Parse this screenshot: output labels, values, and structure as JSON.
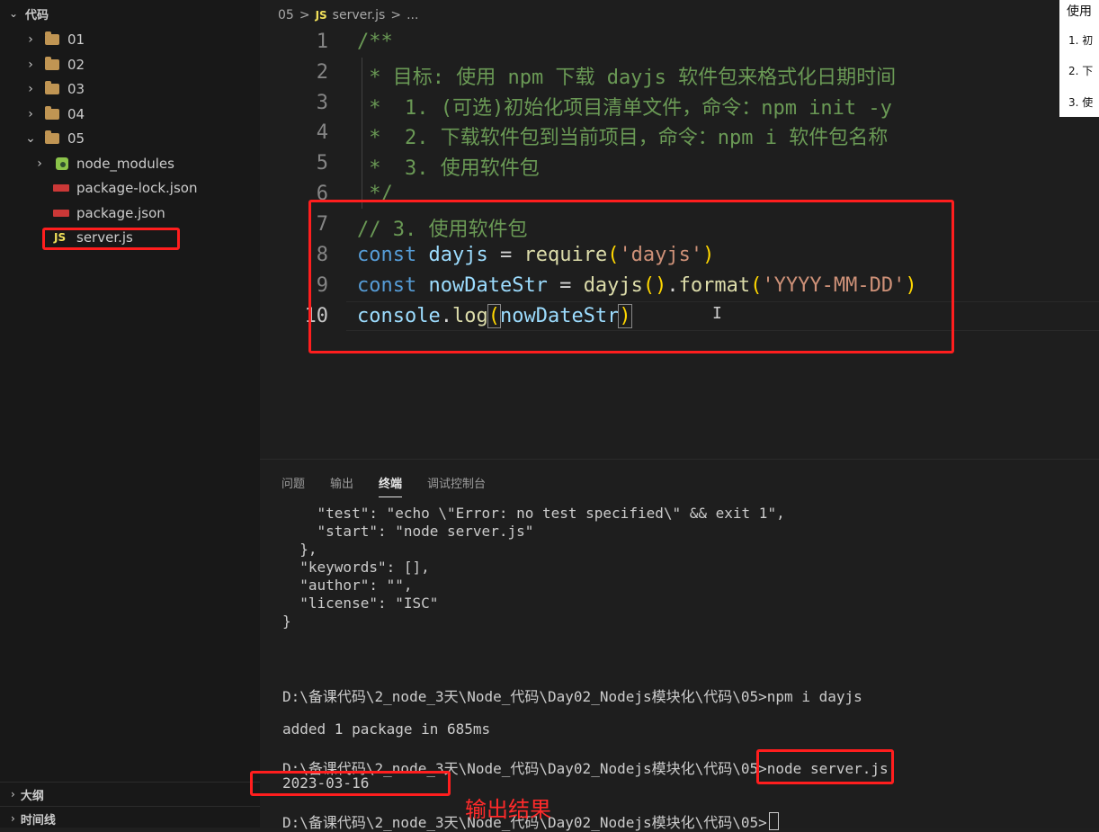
{
  "sidebar": {
    "root_label": "代码",
    "items": [
      {
        "label": "01"
      },
      {
        "label": "02"
      },
      {
        "label": "03"
      },
      {
        "label": "04"
      },
      {
        "label": "05"
      }
    ],
    "children": [
      {
        "label": "node_modules"
      },
      {
        "label": "package-lock.json"
      },
      {
        "label": "package.json"
      },
      {
        "label": "server.js"
      }
    ],
    "outline_label": "大纲",
    "timeline_label": "时间线"
  },
  "editor": {
    "breadcrumb": {
      "folder": "05",
      "sep1": ">",
      "js_badge": "JS",
      "file": "server.js",
      "sep2": ">",
      "ellipsis": "..."
    },
    "line_numbers": [
      "1",
      "2",
      "3",
      "4",
      "5",
      "6",
      "7",
      "8",
      "9",
      "10"
    ],
    "lines": {
      "l1": "/**",
      "l2": " * 目标: 使用 npm 下载 dayjs 软件包来格式化日期时间",
      "l3": " *  1. (可选)初始化项目清单文件，命令：npm init -y",
      "l4": " *  2. 下载软件包到当前项目，命令：npm i 软件包名称",
      "l5": " *  3. 使用软件包",
      "l6": " */",
      "l7": "// 3. 使用软件包",
      "l8": {
        "kw": "const",
        "name": " dayjs",
        "eq": " = ",
        "fn": "require",
        "p1": "(",
        "str": "'dayjs'",
        "p2": ")"
      },
      "l9": {
        "kw": "const",
        "name": " nowDateStr",
        "eq": " = ",
        "fn1": "dayjs",
        "p1": "()",
        "dot": ".",
        "fn2": "format",
        "p2": "(",
        "str": "'YYYY-MM-DD'",
        "p3": ")"
      },
      "l10": {
        "obj": "console",
        "dot": ".",
        "fn": "log",
        "p1": "(",
        "arg": "nowDateStr",
        "p2": ")"
      }
    }
  },
  "preview": {
    "title": "使用",
    "items": [
      {
        "num": "1.",
        "text": "初"
      },
      {
        "num": "2.",
        "text": "下"
      },
      {
        "num": "3.",
        "text": "使"
      }
    ]
  },
  "panel": {
    "tabs": [
      "问题",
      "输出",
      "终端",
      "调试控制台"
    ],
    "active_tab": "终端",
    "terminal_lines": [
      "    \"test\": \"echo \\\"Error: no test specified\\\" && exit 1\",",
      "    \"start\": \"node server.js\"",
      "  },",
      "  \"keywords\": [],",
      "  \"author\": \"\",",
      "  \"license\": \"ISC\"",
      "}",
      "",
      "",
      "D:\\备课代码\\2_node_3天\\Node_代码\\Day02_Nodejs模块化\\代码\\05>npm i dayjs",
      "",
      "added 1 package in 685ms",
      "",
      "D:\\备课代码\\2_node_3天\\Node_代码\\Day02_Nodejs模块化\\代码\\05>node server.js",
      "2023-03-16",
      "",
      "D:\\备课代码\\2_node_3天\\Node_代码\\Day02_Nodejs模块化\\代码\\05>"
    ]
  },
  "annotation": {
    "output_label": "输出结果",
    "color": "#ff1e1e"
  }
}
